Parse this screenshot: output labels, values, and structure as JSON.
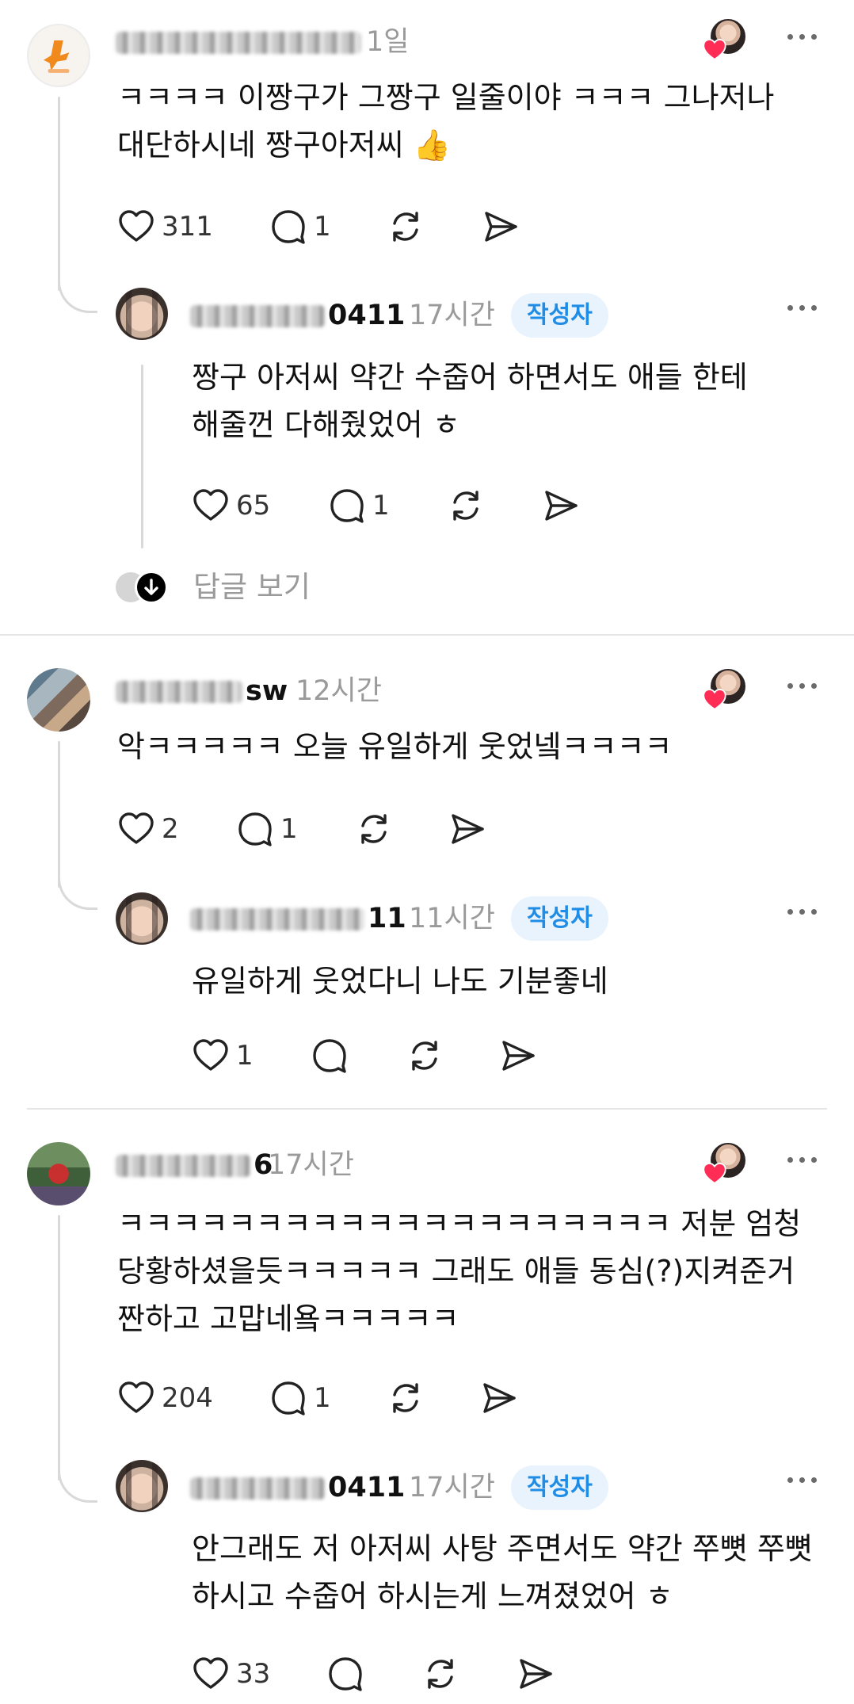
{
  "comments": [
    {
      "user_visible": "happy_bongeol",
      "time": "1일",
      "lines": [
        "ㅋㅋㅋㅋ 이짱구가 그짱구 일줄이야 ㅋㅋㅋ 그나저나",
        "대단하시네  짱구아저씨 👍"
      ],
      "likes": "311",
      "replies": "1",
      "reply": {
        "user_tail": "0411",
        "time": "17시간",
        "badge": "작성자",
        "lines": [
          "짱구 아저씨 약간 수줍어 하면서도 애들 한테",
          "해줄껀 다해줬었어 ㅎ"
        ],
        "likes": "65",
        "replies": "1"
      },
      "view_replies": "답글 보기"
    },
    {
      "user_tail": "sw",
      "time": "12시간",
      "lines": [
        "악ㅋㅋㅋㅋㅋ 오늘 유일하게 웃었넼ㅋㅋㅋㅋ"
      ],
      "likes": "2",
      "replies": "1",
      "reply": {
        "user_tail": "11",
        "time": "11시간",
        "badge": "작성자",
        "lines": [
          "유일하게 웃었다니 나도 기분좋네"
        ],
        "likes": "1",
        "replies": ""
      }
    },
    {
      "user_tail": "6",
      "time": "17시간",
      "lines": [
        "ㅋㅋㅋㅋㅋㅋㅋㅋㅋㅋㅋㅋㅋㅋㅋㅋㅋㅋㅋㅋ 저분 엄청",
        "당황하셨을듯ㅋㅋㅋㅋㅋ 그래도 애들 동심(?)지켜준거",
        "짠하고 고맙네욬ㅋㅋㅋㅋㅋ"
      ],
      "likes": "204",
      "replies": "1",
      "reply": {
        "user_tail": "0411",
        "time": "17시간",
        "badge": "작성자",
        "lines": [
          "안그래도 저 아저씨 사탕 주면서도 약간 쭈뼛 쭈뼛",
          "하시고 수줍어 하시는게 느껴졌었어 ㅎ"
        ],
        "likes": "33",
        "replies": ""
      }
    }
  ],
  "icons": {
    "like": "heart-outline-icon",
    "reply": "speech-bubble-icon",
    "repost": "repost-icon",
    "share": "send-icon",
    "more": "more-dots-icon",
    "liked_by_author": "author-liked-heart-icon",
    "view_replies": "arrow-down-icon"
  },
  "colors": {
    "badge_text": "#1f8ce6",
    "badge_bg": "#e8f3fd",
    "heart": "#ff2d55",
    "muted": "#9a9a9a"
  }
}
